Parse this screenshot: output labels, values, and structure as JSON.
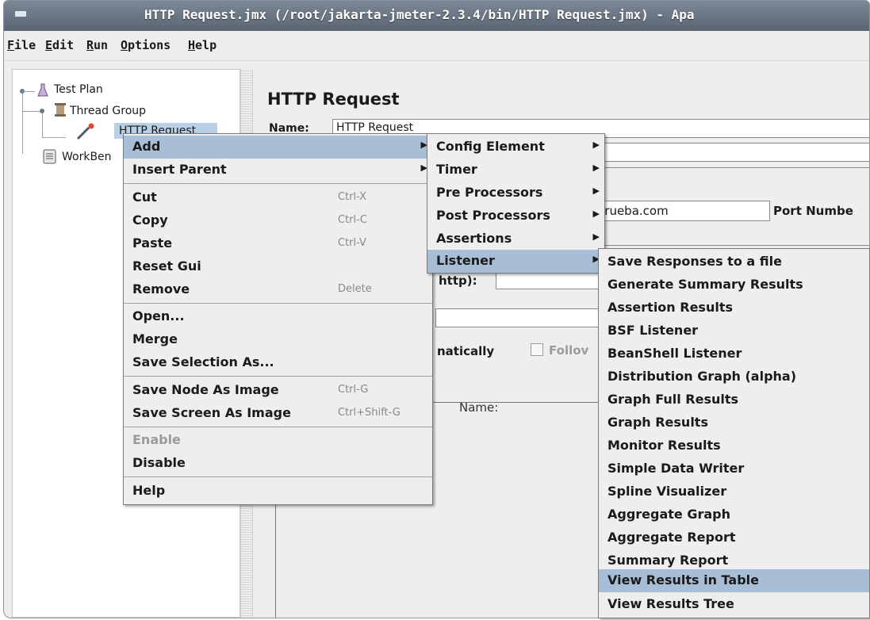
{
  "window": {
    "title": "HTTP Request.jmx (/root/jakarta-jmeter-2.3.4/bin/HTTP Request.jmx) - Apa"
  },
  "menubar": [
    {
      "first": "F",
      "rest": "ile"
    },
    {
      "first": "E",
      "rest": "dit"
    },
    {
      "first": "R",
      "rest": "un"
    },
    {
      "first": "O",
      "rest": "ptions"
    },
    {
      "first": "H",
      "rest": "elp"
    }
  ],
  "tree": {
    "test_plan": "Test Plan",
    "thread_group": "Thread Group",
    "http_request": "HTTP Request",
    "workbench": "WorkBen"
  },
  "panel": {
    "title": "HTTP Request",
    "name_label": "Name:",
    "name_value": "HTTP Request",
    "server_value": "deprueba.com",
    "port_label": "Port Numbe",
    "http_label": "http):",
    "auto_label": "natically",
    "follow_label": "Follov",
    "params_name_header": "Name:"
  },
  "context_menu": {
    "items": [
      {
        "label": "Add",
        "accel": "",
        "submenu": true,
        "highlighted": true
      },
      {
        "label": "Insert Parent",
        "accel": "",
        "submenu": true
      },
      {
        "label": "Cut",
        "accel": "Ctrl-X"
      },
      {
        "label": "Copy",
        "accel": "Ctrl-C"
      },
      {
        "label": "Paste",
        "accel": "Ctrl-V"
      },
      {
        "label": "Reset Gui",
        "accel": ""
      },
      {
        "label": "Remove",
        "accel": "Delete"
      },
      {
        "label": "Open...",
        "accel": ""
      },
      {
        "label": "Merge",
        "accel": ""
      },
      {
        "label": "Save Selection As...",
        "accel": ""
      },
      {
        "label": "Save Node As Image",
        "accel": "Ctrl-G"
      },
      {
        "label": "Save Screen As Image",
        "accel": "Ctrl+Shift-G"
      },
      {
        "label": "Enable",
        "accel": "",
        "disabled": true
      },
      {
        "label": "Disable",
        "accel": ""
      },
      {
        "label": "Help",
        "accel": ""
      }
    ]
  },
  "add_submenu": {
    "items": [
      {
        "label": "Config Element",
        "submenu": true
      },
      {
        "label": "Timer",
        "submenu": true
      },
      {
        "label": "Pre Processors",
        "submenu": true
      },
      {
        "label": "Post Processors",
        "submenu": true
      },
      {
        "label": "Assertions",
        "submenu": true
      },
      {
        "label": "Listener",
        "submenu": true,
        "highlighted": true
      }
    ]
  },
  "listener_submenu": {
    "items": [
      {
        "label": "Save Responses to a file"
      },
      {
        "label": "Generate Summary Results"
      },
      {
        "label": "Assertion Results"
      },
      {
        "label": "BSF Listener"
      },
      {
        "label": "BeanShell Listener"
      },
      {
        "label": "Distribution Graph (alpha)"
      },
      {
        "label": "Graph Full Results"
      },
      {
        "label": "Graph Results"
      },
      {
        "label": "Monitor Results"
      },
      {
        "label": "Simple Data Writer"
      },
      {
        "label": "Spline Visualizer"
      },
      {
        "label": "Aggregate Graph"
      },
      {
        "label": "Aggregate Report"
      },
      {
        "label": "Summary Report"
      },
      {
        "label": "View Results in Table",
        "highlighted": true
      },
      {
        "label": "View Results Tree"
      }
    ]
  },
  "colors": {
    "highlight": "#a8bed6",
    "titlebar": "#6b7684",
    "menu_bg": "#eeeeee"
  }
}
